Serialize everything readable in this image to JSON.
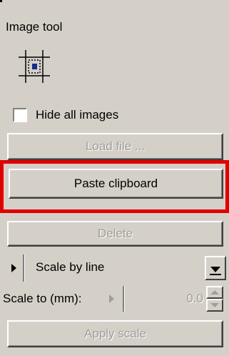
{
  "panel": {
    "title": "Image tool",
    "tool_icon": "image-crop-icon"
  },
  "options": {
    "hide_all_images_label": "Hide all images",
    "hide_all_images_checked": false
  },
  "buttons": {
    "load_file": "Load file ...",
    "paste_clipboard": "Paste clipboard",
    "delete": "Delete",
    "apply_scale": "Apply scale"
  },
  "scale": {
    "mode_selected": "Scale by line",
    "scale_to_label": "Scale to (mm):",
    "scale_value": "0.0"
  },
  "colors": {
    "panel_bg": "#d4d0c8",
    "highlight": "#e00000",
    "icon_accent": "#1a2a8c",
    "disabled_text": "#a09d98"
  }
}
